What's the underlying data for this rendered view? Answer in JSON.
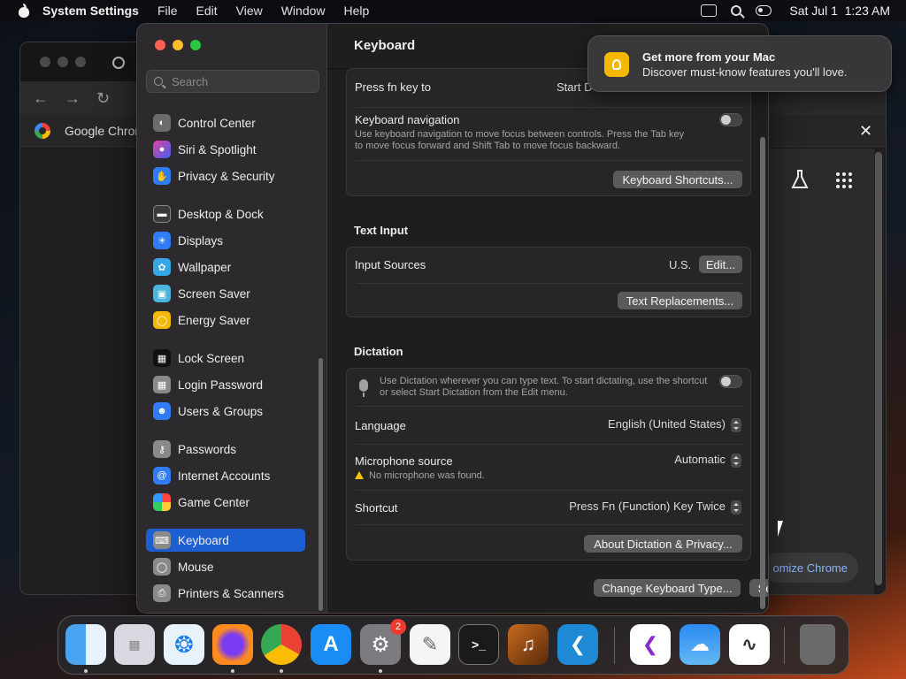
{
  "menubar": {
    "app_name": "System Settings",
    "menus": [
      "File",
      "Edit",
      "View",
      "Window",
      "Help"
    ],
    "clock": "Sat Jul 1  1:23 AM"
  },
  "chrome": {
    "bookmark_label": "Google Chrom",
    "customize_label": "omize Chrome"
  },
  "notification": {
    "title": "Get more from your Mac",
    "body": "Discover must-know features you'll love."
  },
  "sidebar": {
    "search_placeholder": "Search",
    "items": [
      {
        "label": "Control Center",
        "icon": "control-center-icon",
        "color": "#6b6b6b"
      },
      {
        "label": "Siri & Spotlight",
        "icon": "siri-icon",
        "color": "#b03cd0"
      },
      {
        "label": "Privacy & Security",
        "icon": "hand-icon",
        "color": "#2f7cf6"
      },
      {
        "label": "Desktop & Dock",
        "icon": "dock-icon",
        "color": "#3a3a3a"
      },
      {
        "label": "Displays",
        "icon": "sun-icon",
        "color": "#2f7cf6"
      },
      {
        "label": "Wallpaper",
        "icon": "flower-icon",
        "color": "#35a6e8"
      },
      {
        "label": "Screen Saver",
        "icon": "screensaver-icon",
        "color": "#4ab6e0"
      },
      {
        "label": "Energy Saver",
        "icon": "bulb-icon",
        "color": "#f5b800"
      },
      {
        "label": "Lock Screen",
        "icon": "lock-icon",
        "color": "#222222"
      },
      {
        "label": "Login Password",
        "icon": "lock-icon",
        "color": "#8a8a8a"
      },
      {
        "label": "Users & Groups",
        "icon": "users-icon",
        "color": "#2f7cf6"
      },
      {
        "label": "Passwords",
        "icon": "key-icon",
        "color": "#8a8a8a"
      },
      {
        "label": "Internet Accounts",
        "icon": "at-icon",
        "color": "#2f7cf6"
      },
      {
        "label": "Game Center",
        "icon": "game-center-icon",
        "color": "#e8e8e8"
      },
      {
        "label": "Keyboard",
        "icon": "keyboard-icon",
        "color": "#8a8a8a"
      },
      {
        "label": "Mouse",
        "icon": "mouse-icon",
        "color": "#8a8a8a"
      },
      {
        "label": "Printers & Scanners",
        "icon": "printer-icon",
        "color": "#8a8a8a"
      }
    ]
  },
  "content": {
    "title": "Keyboard",
    "fn_row": {
      "label": "Press fn key to",
      "value": "Start D"
    },
    "kbd_nav": {
      "label": "Keyboard navigation",
      "desc1": "Use keyboard navigation to move focus between controls. Press the Tab key",
      "desc2": "to move focus forward and Shift Tab to move focus backward."
    },
    "shortcuts_button": "Keyboard Shortcuts...",
    "text_input_title": "Text Input",
    "input_sources": {
      "label": "Input Sources",
      "value": "U.S.",
      "button": "Edit..."
    },
    "text_replacements_button": "Text Replacements...",
    "dictation_title": "Dictation",
    "dictation_desc1": "Use Dictation wherever you can type text. To start dictating, use the shortcut",
    "dictation_desc2": "or select Start Dictation from the Edit menu.",
    "language": {
      "label": "Language",
      "value": "English (United States)"
    },
    "mic_source": {
      "label": "Microphone source",
      "value": "Automatic",
      "warning": "No microphone was found."
    },
    "shortcut": {
      "label": "Shortcut",
      "value": "Press Fn (Function) Key Twice"
    },
    "about_button": "About Dictation & Privacy...",
    "change_type_button": "Change Keyboard Type...",
    "setup_button": "Set Up Keyboard...",
    "help": "?"
  },
  "dock": {
    "badge_count": "2"
  }
}
